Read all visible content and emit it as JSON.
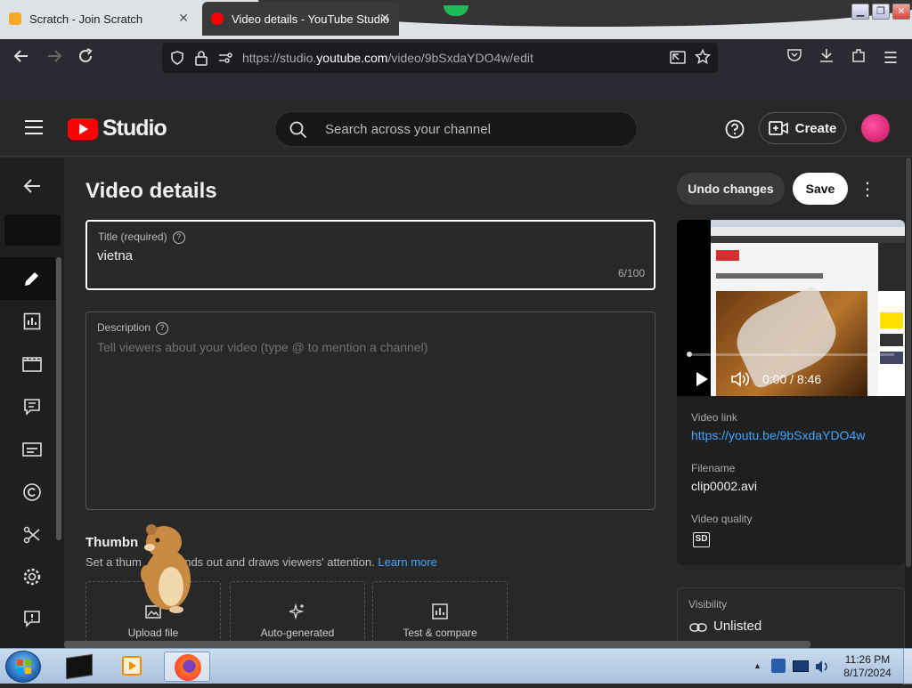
{
  "browser": {
    "tabs": [
      {
        "title": "Scratch - Join Scratch",
        "active": false
      },
      {
        "title": "Video details - YouTube Studio",
        "active": true
      }
    ],
    "url_prefix": "https://studio.",
    "url_domain": "youtube.com",
    "url_rest": "/video/9bSxdaYDO4w/edit"
  },
  "header": {
    "logo_text": "Studio",
    "search_placeholder": "Search across your channel",
    "create_label": "Create"
  },
  "page": {
    "title": "Video details",
    "title_field": {
      "label": "Title (required)",
      "value": "vietna",
      "counter": "6/100"
    },
    "description_field": {
      "label": "Description",
      "placeholder": "Tell viewers about your video (type @ to mention a channel)"
    },
    "thumbnail": {
      "heading": "Thumbn",
      "desc_a": "Set a thum",
      "desc_b": "stands out and draws viewers' attention.",
      "learn_more": "Learn more",
      "options": [
        {
          "label": "Upload file",
          "icon": "image-upload-icon"
        },
        {
          "label": "Auto-generated",
          "icon": "sparkle-icon"
        },
        {
          "label": "Test & compare",
          "icon": "chart-icon"
        }
      ]
    }
  },
  "actions": {
    "undo": "Undo changes",
    "save": "Save"
  },
  "video": {
    "time": "0:00 / 8:46",
    "link_label": "Video link",
    "link": "https://youtu.be/9bSxdaYDO4w",
    "filename_label": "Filename",
    "filename": "clip0002.avi",
    "quality_label": "Video quality",
    "quality_badge": "SD",
    "progress": 0
  },
  "visibility": {
    "label": "Visibility",
    "value": "Unlisted"
  },
  "taskbar": {
    "time": "11:26 PM",
    "date": "8/17/2024"
  },
  "colors": {
    "accent": "#3ea6ff",
    "brand_red": "#ff0000",
    "bg": "#282828"
  }
}
